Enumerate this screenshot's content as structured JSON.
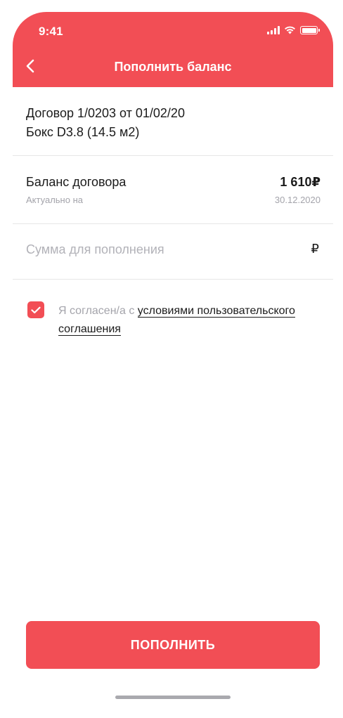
{
  "status_bar": {
    "time": "9:41"
  },
  "header": {
    "title": "Пополнить баланс"
  },
  "contract": {
    "line1": "Договор 1/0203 от 01/02/20",
    "line2": "Бокс D3.8 (14.5 м2)"
  },
  "balance": {
    "label": "Баланс договора",
    "value": "1 610₽",
    "date_label": "Актуально на",
    "date": "30.12.2020"
  },
  "amount": {
    "placeholder": "Сумма для пополнения",
    "value": "",
    "currency": "₽"
  },
  "agreement": {
    "checked": true,
    "prefix": "Я согласен/а с ",
    "link_text": "условиями пользовательского соглашения"
  },
  "submit": {
    "label": "ПОПОЛНИТЬ"
  },
  "colors": {
    "accent": "#f24e55",
    "muted": "#a4a4ab",
    "divider": "#e6e6e6"
  }
}
